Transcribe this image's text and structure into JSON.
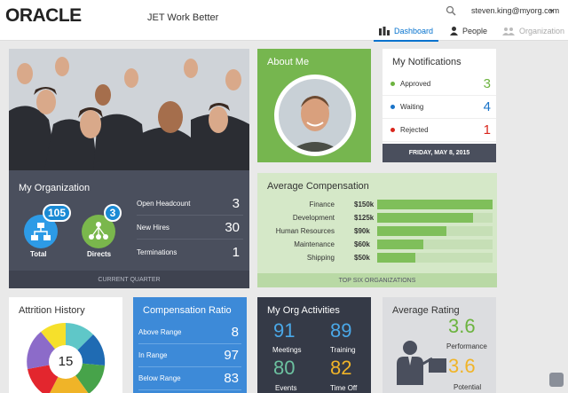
{
  "header": {
    "logo": "ORACLE",
    "app_title": "JET Work Better",
    "user": "steven.king@myorg.com",
    "tabs": [
      {
        "label": "Dashboard",
        "icon": "bar-chart-icon"
      },
      {
        "label": "People",
        "icon": "person-icon"
      },
      {
        "label": "Organization",
        "icon": "group-icon"
      }
    ]
  },
  "org": {
    "title": "My Organization",
    "total_count": "105",
    "total_label": "Total",
    "directs_count": "3",
    "directs_label": "Directs",
    "rows": [
      {
        "label": "Open Headcount",
        "value": "3"
      },
      {
        "label": "New Hires",
        "value": "30"
      },
      {
        "label": "Terminations",
        "value": "1"
      }
    ],
    "footer": "CURRENT QUARTER"
  },
  "about": {
    "title": "About Me"
  },
  "notifications": {
    "title": "My Notifications",
    "rows": [
      {
        "label": "Approved",
        "value": "3",
        "color": "#6cb33f"
      },
      {
        "label": "Waiting",
        "value": "4",
        "color": "#1a73c8"
      },
      {
        "label": "Rejected",
        "value": "1",
        "color": "#d9261c"
      }
    ],
    "date": "FRIDAY, MAY 8, 2015"
  },
  "compensation": {
    "title": "Average Compensation",
    "footer": "TOP SIX ORGANIZATIONS",
    "rows": [
      {
        "name": "Finance",
        "label": "$150k",
        "value": 150
      },
      {
        "name": "Development",
        "label": "$125k",
        "value": 125
      },
      {
        "name": "Human Resources",
        "label": "$90k",
        "value": 90
      },
      {
        "name": "Maintenance",
        "label": "$60k",
        "value": 60
      },
      {
        "name": "Shipping",
        "label": "$50k",
        "value": 50
      }
    ]
  },
  "attrition": {
    "title": "Attrition History",
    "center": "15"
  },
  "ratio": {
    "title": "Compensation Ratio",
    "rows": [
      {
        "label": "Above Range",
        "value": "8"
      },
      {
        "label": "In Range",
        "value": "97"
      },
      {
        "label": "Below Range",
        "value": "83"
      }
    ]
  },
  "activities": {
    "title": "My Org Activities",
    "items": [
      {
        "value": "91",
        "label": "Meetings",
        "color": "#4aa8e8"
      },
      {
        "value": "89",
        "label": "Training",
        "color": "#4aa8e8"
      },
      {
        "value": "80",
        "label": "Events",
        "color": "#6cc1a0"
      },
      {
        "value": "82",
        "label": "Time Off",
        "color": "#f0b428"
      }
    ]
  },
  "rating": {
    "title": "Average Rating",
    "performance": "3.6",
    "performance_label": "Performance",
    "potential": "3.6",
    "potential_label": "Potential"
  }
}
